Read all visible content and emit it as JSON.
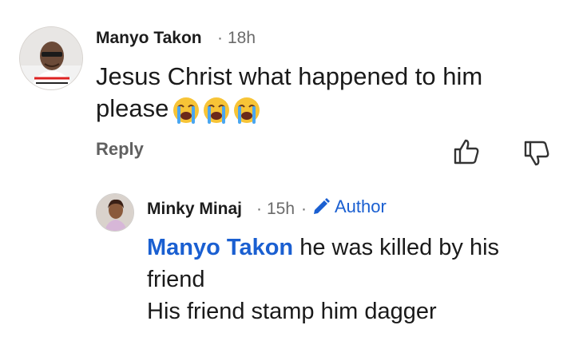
{
  "comment": {
    "author": "Manyo Takon",
    "separator": "·",
    "time": "18h",
    "text": "Jesus Christ what happened to him please",
    "emojis": [
      "crying-face",
      "crying-face",
      "crying-face"
    ],
    "reply_label": "Reply",
    "like_icon": "thumbs-up-icon",
    "dislike_icon": "thumbs-down-icon"
  },
  "reply": {
    "author": "Minky Minaj",
    "separator": "·",
    "time": "15h",
    "separator2": "·",
    "badge_label": "Author",
    "badge_icon": "pencil-icon",
    "mention": "Manyo Takon",
    "text_line1": " he was killed by his friend",
    "text_line2": "His friend stamp him dagger"
  },
  "colors": {
    "link_blue": "#1a5fd1",
    "meta_gray": "#6b6b6b"
  }
}
